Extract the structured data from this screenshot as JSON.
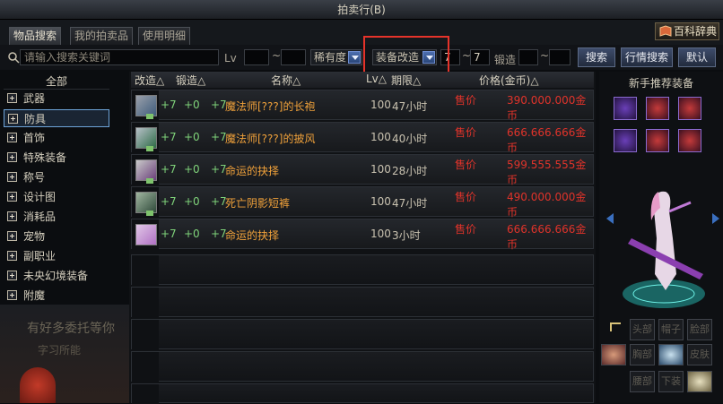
{
  "window": {
    "title": "拍卖行(B)"
  },
  "tabs": [
    "物品搜索",
    "我的拍卖品",
    "使用明细"
  ],
  "baike_label": "百科辞典",
  "search": {
    "placeholder": "请输入搜索关键词",
    "lv_label": "Lv",
    "lv_from": "",
    "lv_to": "",
    "tilde": "~",
    "rarity": "稀有度",
    "upgrade_type": "装备改造",
    "upgrade_from": "7",
    "upgrade_to": "7",
    "forge_label": "锻造",
    "forge_from": "",
    "forge_to": ""
  },
  "buttons": {
    "search": "搜索",
    "market": "行情搜索",
    "default": "默认"
  },
  "categories": {
    "all": "全部",
    "items": [
      "武器",
      "防具",
      "首饰",
      "特殊装备",
      "称号",
      "设计图",
      "消耗品",
      "宠物",
      "副职业",
      "未央幻境装备",
      "附魔"
    ],
    "selected": "防具"
  },
  "table": {
    "headers": {
      "upgrade": "改造△",
      "forge": "锻造△",
      "name": "名称△",
      "lv": "Lv△",
      "period": "期限△",
      "price": "价格(金币)△"
    },
    "rows": [
      {
        "upgrade": "+7",
        "forge": "+0",
        "enhance": "+7",
        "name": "魔法师[???]的长袍",
        "lv": "100",
        "period": "47小时",
        "price_label": "售价",
        "price": "390.000.000金币",
        "icon": "robe-icon"
      },
      {
        "upgrade": "+7",
        "forge": "+0",
        "enhance": "+7",
        "name": "魔法师[???]的披风",
        "lv": "100",
        "period": "40小时",
        "price_label": "售价",
        "price": "666.666.666金币",
        "icon": "cape-icon"
      },
      {
        "upgrade": "+7",
        "forge": "+0",
        "enhance": "+7",
        "name": "命运的抉择",
        "lv": "100",
        "period": "28小时",
        "price_label": "售价",
        "price": "599.555.555金币",
        "icon": "choice-icon"
      },
      {
        "upgrade": "+7",
        "forge": "+0",
        "enhance": "+7",
        "name": "死亡阴影短裤",
        "lv": "100",
        "period": "47小时",
        "price_label": "售价",
        "price": "490.000.000金币",
        "icon": "shorts-icon"
      },
      {
        "upgrade": "+7",
        "forge": "+0",
        "enhance": "+7",
        "name": "命运的抉择",
        "lv": "100",
        "period": "3小时",
        "price_label": "售价",
        "price": "666.666.666金币",
        "icon": "choice-icon-2"
      }
    ]
  },
  "background": {
    "text1": "有好多委托等你",
    "text2": "字习所能"
  },
  "recommend": {
    "title": "新手推荐装备",
    "parts": [
      "头部",
      "帽子",
      "脸部",
      "胸部",
      "皮肤",
      "腰部",
      "下装"
    ]
  },
  "colors": {
    "accent": "#e5332a",
    "price": "#e0332a",
    "name": "#f0a13a"
  }
}
